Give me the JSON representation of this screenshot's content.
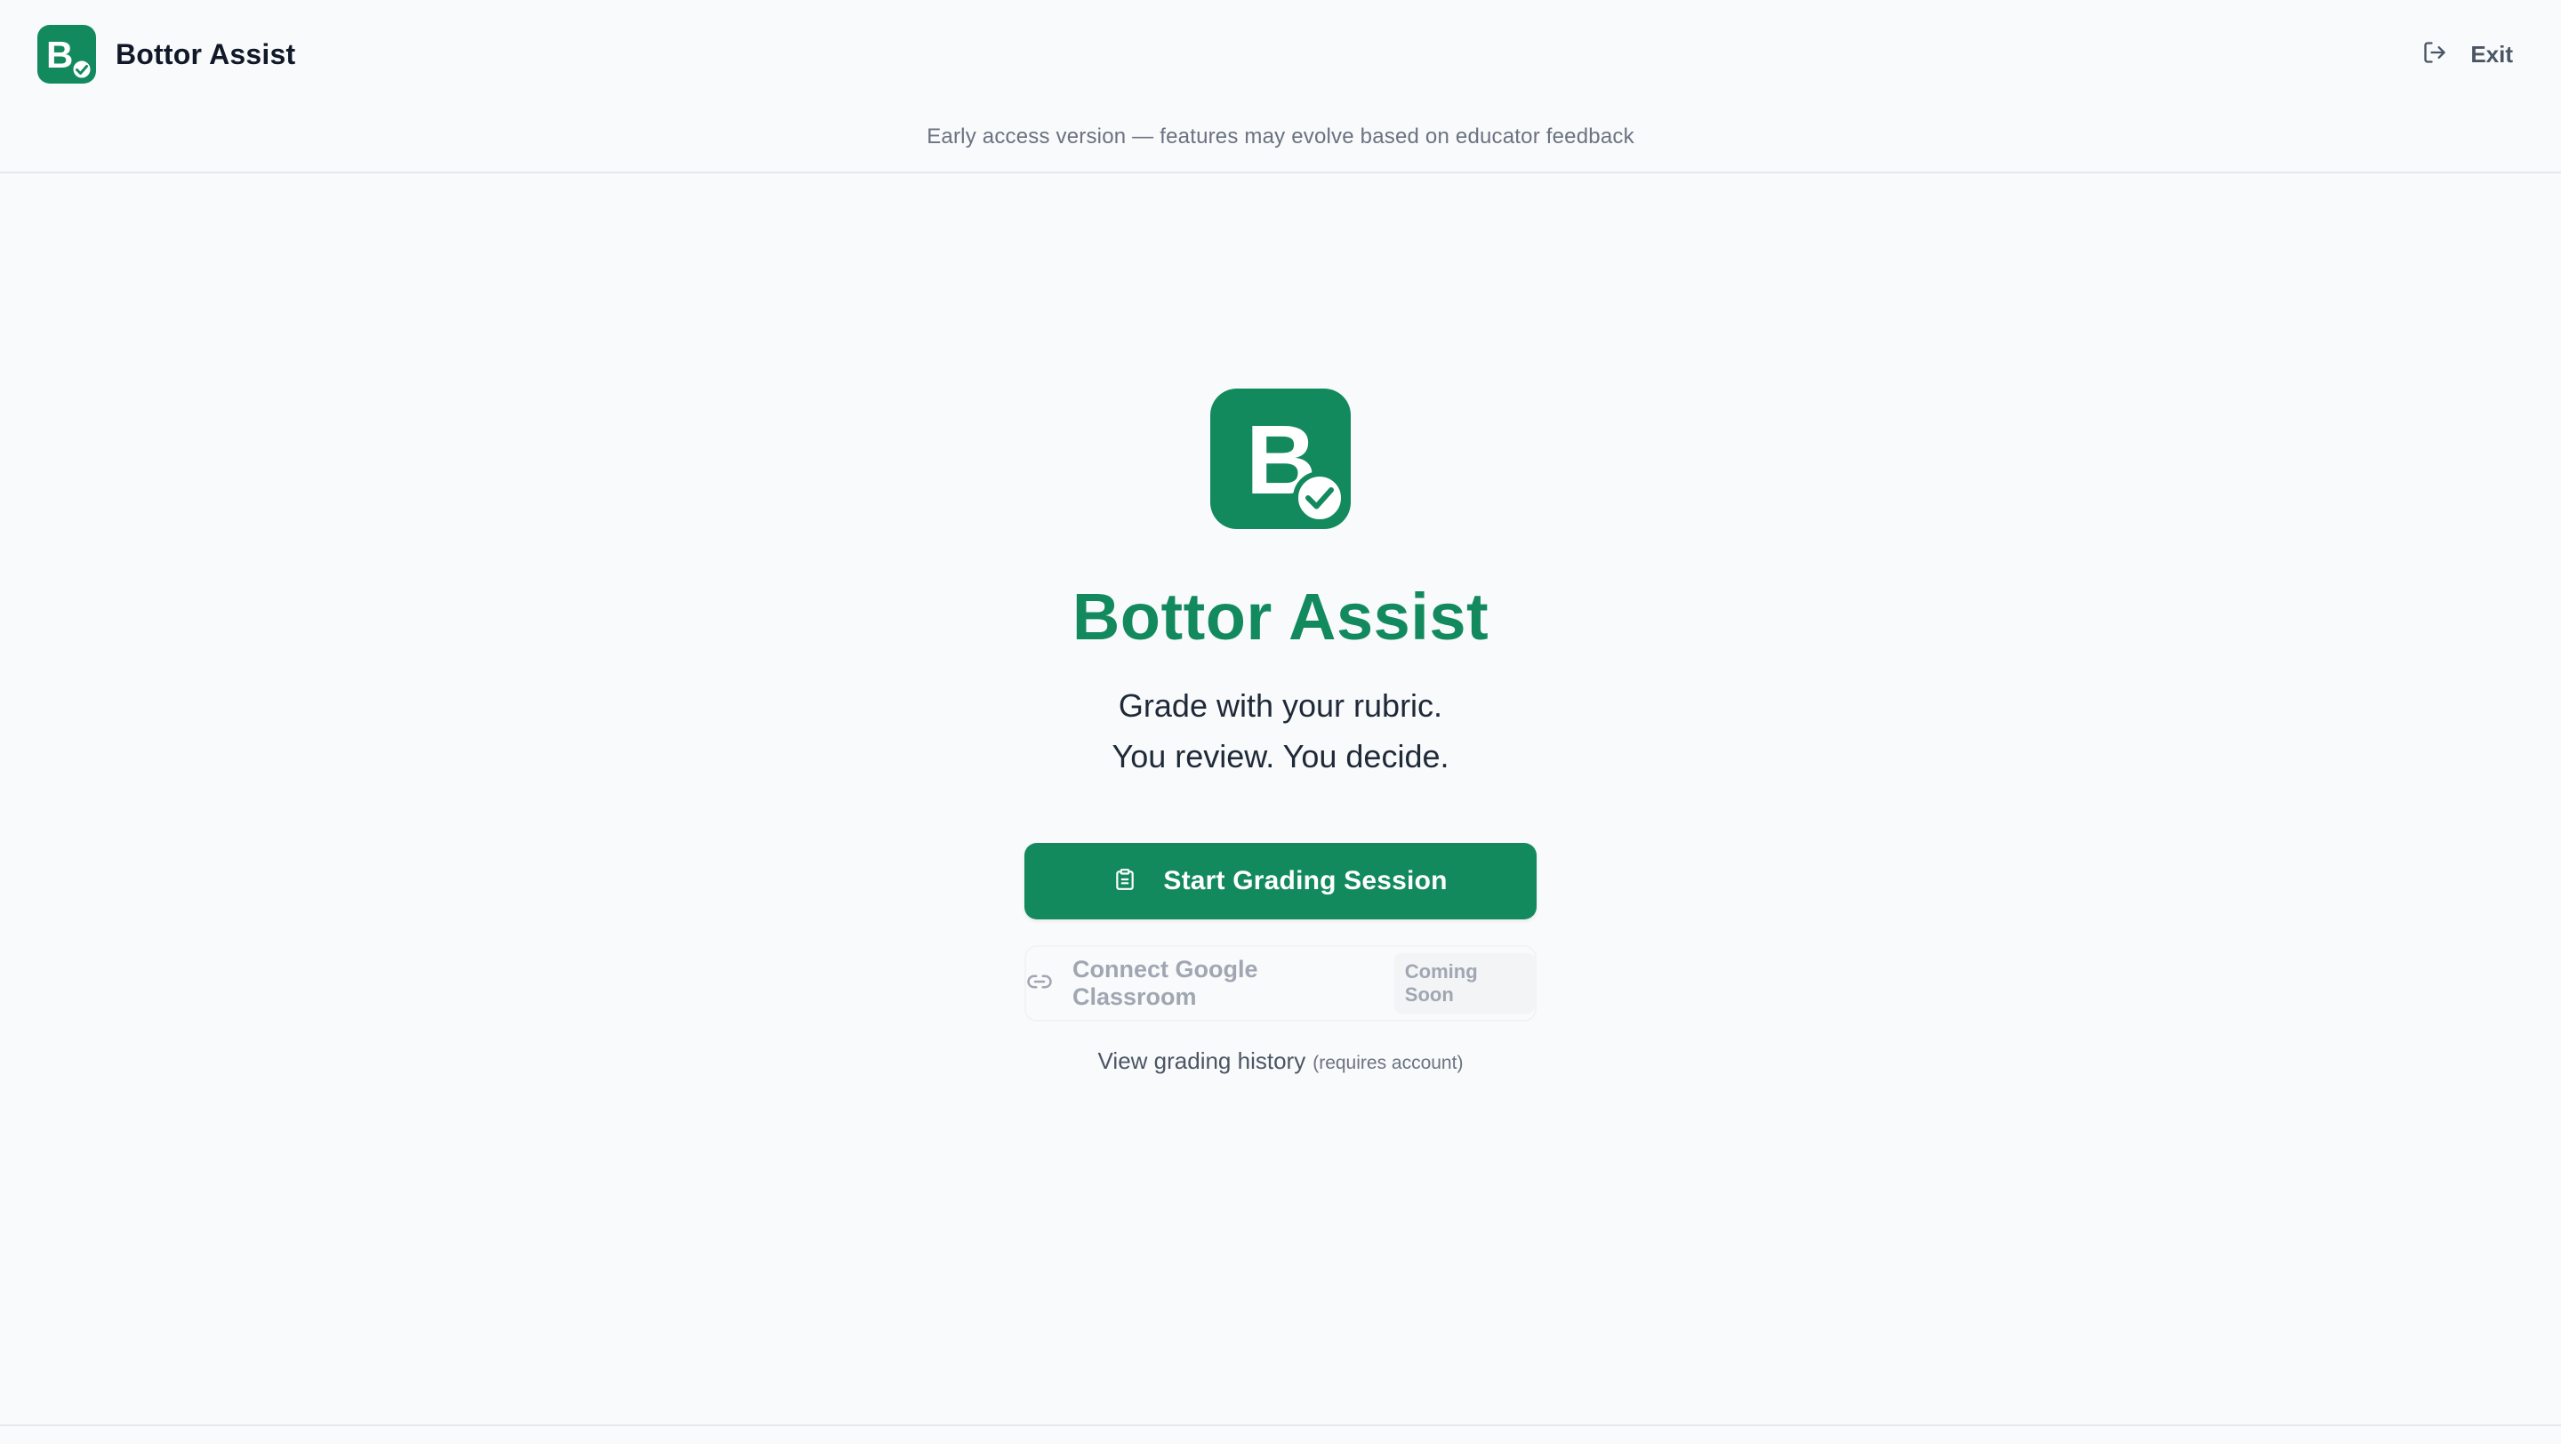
{
  "header": {
    "brand_name": "Bottor Assist",
    "exit_label": "Exit",
    "notice": "Early access version — features may evolve based on educator feedback"
  },
  "hero": {
    "logo_letter": "B",
    "title": "Bottor Assist",
    "tagline_line1": "Grade with your rubric.",
    "tagline_line2": "You review. You decide."
  },
  "actions": {
    "primary_label": "Start Grading Session",
    "primary_icon": "clipboard-icon",
    "secondary_label": "Connect Google Classroom",
    "secondary_icon": "link-icon",
    "secondary_badge": "Coming Soon",
    "history_label": "View grading history",
    "history_note": "(requires account)"
  },
  "colors": {
    "brand_green": "#138a5e",
    "background": "#f8fafc",
    "muted_text": "#9ca3af"
  }
}
